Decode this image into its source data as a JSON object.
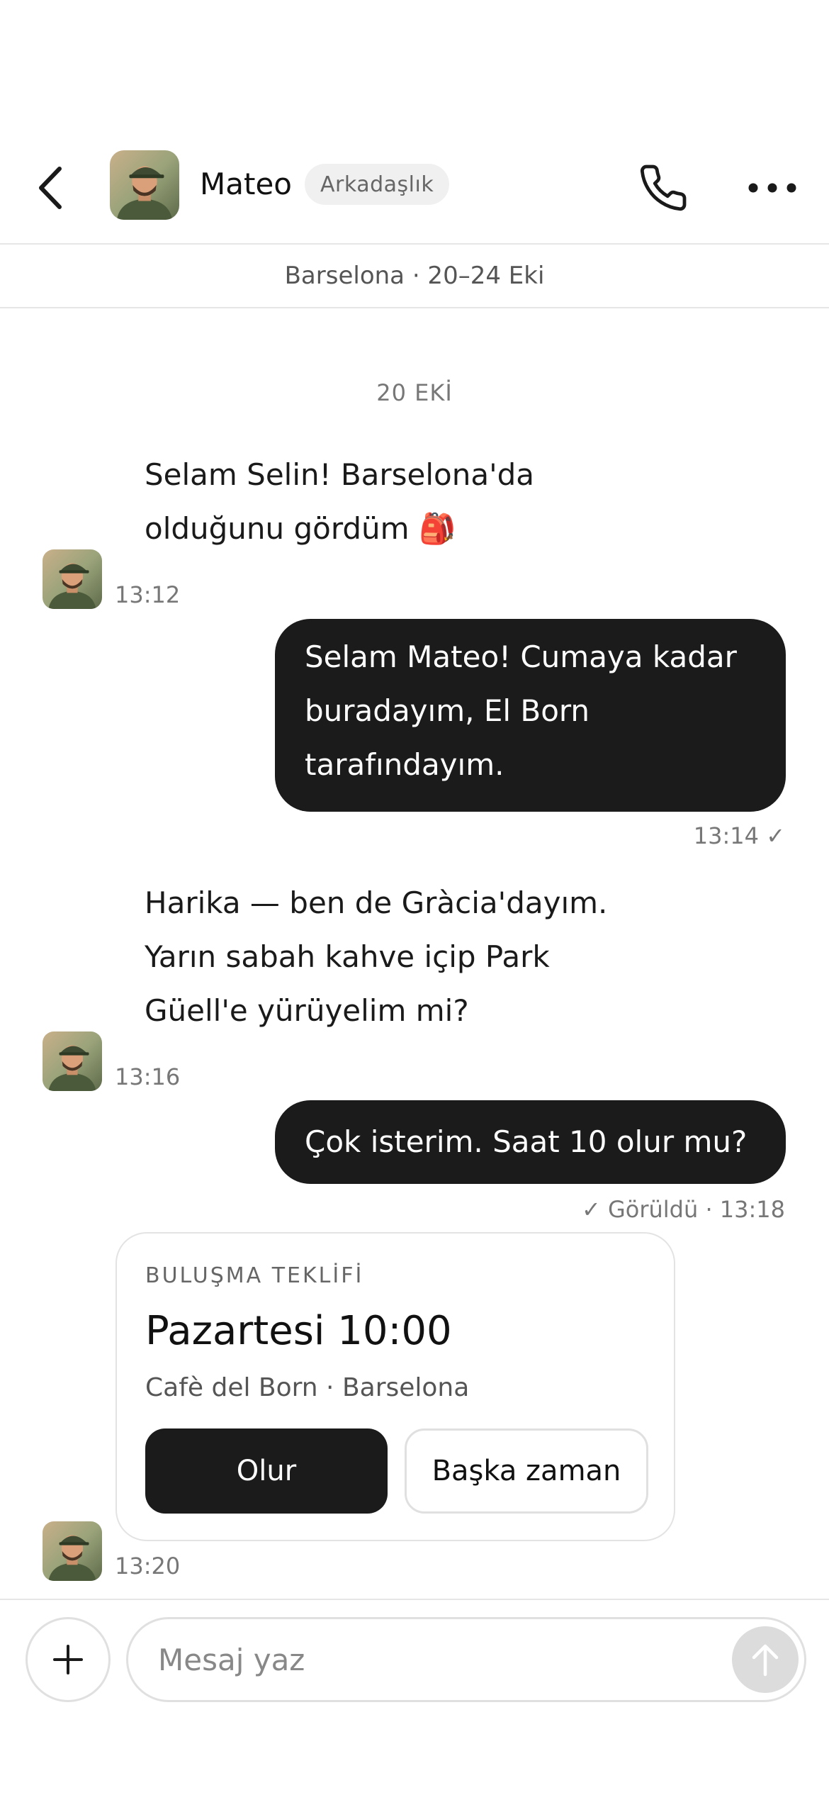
{
  "header": {
    "contact_name": "Mateo",
    "relationship_tag": "Arkadaşlık"
  },
  "context": {
    "trip_info": "Barselona · 20–24 Eki"
  },
  "date_separator": "20 EKİ",
  "messages": [
    {
      "direction": "incoming",
      "lines": [
        "Selam Selin! Barselona'da",
        "olduğunu gördüm 🎒"
      ],
      "time": "13:12"
    },
    {
      "direction": "outgoing",
      "lines": [
        "Selam Mateo! Cumaya kadar",
        "buradayım, El Born",
        "tarafındayım."
      ],
      "status": "13:14 ✓"
    },
    {
      "direction": "incoming",
      "lines": [
        "Harika — ben de Gràcia'dayım.",
        "Yarın sabah kahve içip Park",
        "Güell'e yürüyelim mi?"
      ],
      "time": "13:16"
    },
    {
      "direction": "outgoing",
      "lines": [
        "Çok isterim. Saat 10 olur mu?"
      ],
      "status": "✓ Görüldü · 13:18"
    }
  ],
  "meeting_card": {
    "kicker": "BULUŞMA TEKLİFİ",
    "title": "Pazartesi 10:00",
    "place": "Cafè del Born · Barselona",
    "accept_label": "Olur",
    "other_time_label": "Başka zaman",
    "time": "13:20"
  },
  "composer": {
    "placeholder": "Mesaj yaz"
  },
  "icons": {
    "back": "chevron-left-icon",
    "call": "phone-icon",
    "more": "more-dots-icon",
    "add": "plus-icon",
    "send": "arrow-up-icon"
  },
  "colors": {
    "bubble_dark": "#1b1b1b",
    "divider": "#e6e6e6",
    "muted_text": "#777777"
  }
}
